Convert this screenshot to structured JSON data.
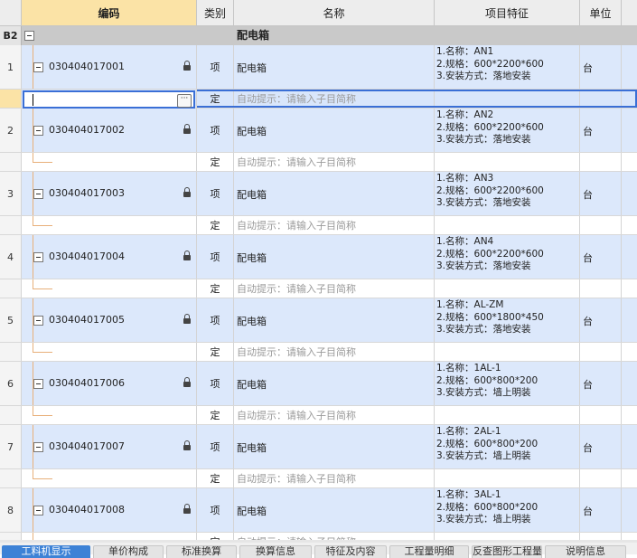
{
  "columns": {
    "code": "编码",
    "type": "类别",
    "name": "名称",
    "feature": "项目特征",
    "unit": "单位"
  },
  "group": {
    "num": "B2",
    "name": "配电箱"
  },
  "sub_row": {
    "type": "定",
    "hint": "自动提示：请输入子目简称"
  },
  "items": [
    {
      "num": "1",
      "code": "030404017001",
      "type": "项",
      "name": "配电箱",
      "unit": "台",
      "features": [
        "1.名称：AN1",
        "2.规格：600*2200*600",
        "3.安装方式：落地安装"
      ]
    },
    {
      "num": "2",
      "code": "030404017002",
      "type": "项",
      "name": "配电箱",
      "unit": "台",
      "features": [
        "1.名称：AN2",
        "2.规格：600*2200*600",
        "3.安装方式：落地安装"
      ]
    },
    {
      "num": "3",
      "code": "030404017003",
      "type": "项",
      "name": "配电箱",
      "unit": "台",
      "features": [
        "1.名称：AN3",
        "2.规格：600*2200*600",
        "3.安装方式：落地安装"
      ]
    },
    {
      "num": "4",
      "code": "030404017004",
      "type": "项",
      "name": "配电箱",
      "unit": "台",
      "features": [
        "1.名称：AN4",
        "2.规格：600*2200*600",
        "3.安装方式：落地安装"
      ]
    },
    {
      "num": "5",
      "code": "030404017005",
      "type": "项",
      "name": "配电箱",
      "unit": "台",
      "features": [
        "1.名称：AL-ZM",
        "2.规格：600*1800*450",
        "3.安装方式：落地安装"
      ]
    },
    {
      "num": "6",
      "code": "030404017006",
      "type": "项",
      "name": "配电箱",
      "unit": "台",
      "features": [
        "1.名称：1AL-1",
        "2.规格：600*800*200",
        "3.安装方式：墙上明装"
      ]
    },
    {
      "num": "7",
      "code": "030404017007",
      "type": "项",
      "name": "配电箱",
      "unit": "台",
      "features": [
        "1.名称：2AL-1",
        "2.规格：600*800*200",
        "3.安装方式：墙上明装"
      ]
    },
    {
      "num": "8",
      "code": "030404017008",
      "type": "项",
      "name": "配电箱",
      "unit": "台",
      "features": [
        "1.名称：3AL-1",
        "2.规格：600*800*200",
        "3.安装方式：墙上明装"
      ]
    }
  ],
  "bottom_tabs": [
    "工料机显示",
    "单价构成",
    "标准换算",
    "换算信息",
    "特征及内容",
    "工程量明细",
    "反查图形工程量",
    "说明信息"
  ],
  "colors": {
    "item_row": "#dce8fb",
    "selection": "#3a6fd6",
    "header_code": "#fbe3a6",
    "group_row": "#c9c9c9"
  }
}
